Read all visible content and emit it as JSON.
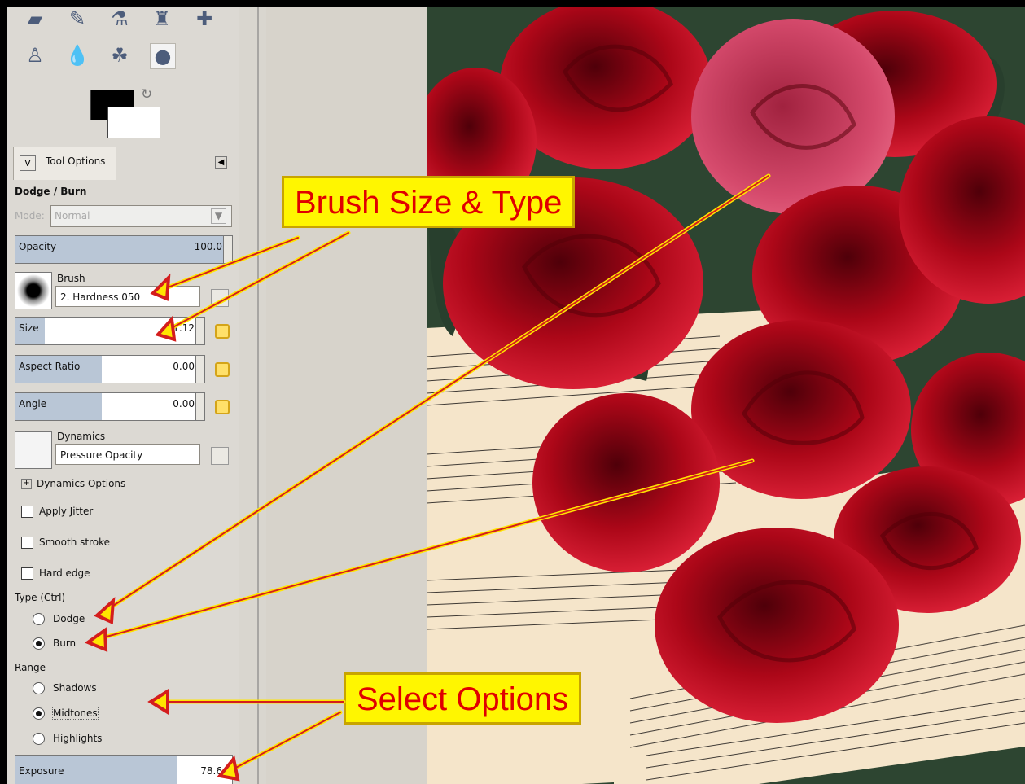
{
  "panel": {
    "title": "Tool Options",
    "tool_name": "Dodge / Burn",
    "mode_label": "Mode:",
    "mode_value": "Normal",
    "opacity_label": "Opacity",
    "opacity_value": "100.0",
    "brush_label": "Brush",
    "brush_value": "2. Hardness 050",
    "size_label": "Size",
    "size_value": "11.12",
    "aspect_label": "Aspect Ratio",
    "aspect_value": "0.00",
    "angle_label": "Angle",
    "angle_value": "0.00",
    "dynamics_label": "Dynamics",
    "dynamics_value": "Pressure Opacity",
    "dynamics_options": "Dynamics Options",
    "apply_jitter": "Apply Jitter",
    "smooth_stroke": "Smooth stroke",
    "hard_edge": "Hard edge",
    "type_label": "Type (Ctrl)",
    "dodge": "Dodge",
    "burn": "Burn",
    "range_label": "Range",
    "shadows": "Shadows",
    "midtones": "Midtones",
    "highlights": "Highlights",
    "exposure_label": "Exposure",
    "exposure_value": "78.6"
  },
  "annotations": {
    "brush_size_type": "Brush Size & Type",
    "select_options": "Select Options"
  },
  "colors": {
    "accent": "#fff600",
    "callout_text": "#e00000",
    "panel": "#dcd9d3",
    "slider": "#b9c6d6"
  }
}
